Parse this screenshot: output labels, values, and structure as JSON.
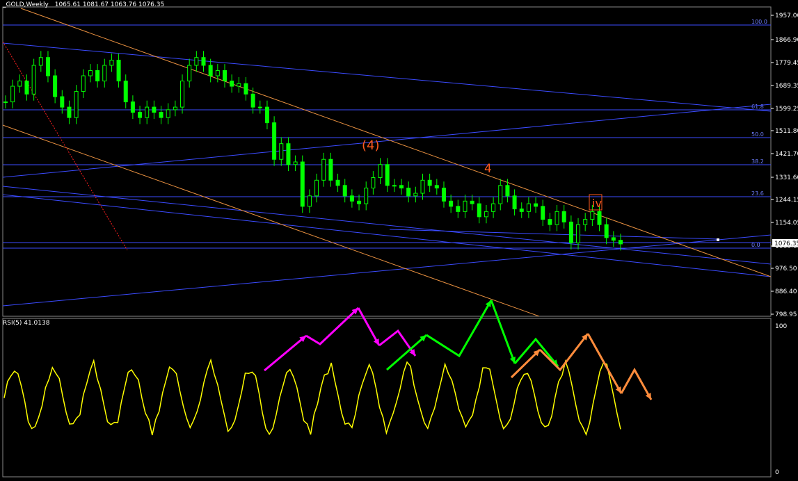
{
  "header": {
    "symbol_label": "_GOLD,Weekly",
    "ohlc": "1065.61 1081.67 1063.76 1076.35"
  },
  "rsi_panel": {
    "label": "RSI(5) 41.0138",
    "axis_ticks": [
      "100",
      "0"
    ]
  },
  "price_axis": {
    "ticks": [
      "1957.00",
      "1866.90",
      "1779.45",
      "1689.35",
      "1599.25",
      "1511.80",
      "1421.70",
      "1331.60",
      "1244.15",
      "1154.05",
      "1066.60",
      "976.50",
      "886.40",
      "798.95"
    ],
    "current_price_label": "1076.35"
  },
  "fibonacci": {
    "levels": [
      "100.0",
      "61.8",
      "50.0",
      "38.2",
      "23.6",
      "0.0"
    ]
  },
  "wave_labels": {
    "w1": "(4)",
    "w2": "4",
    "w3": "iv"
  },
  "colors": {
    "background": "#000000",
    "candle": "#00ff00",
    "horizontal_lines": "#3b4bff",
    "channel_lines": "#e89040",
    "rsi_line": "#ffff00",
    "wave_label": "#ff5a1e",
    "arrow_magenta": "#ff00ff",
    "arrow_green": "#00ff00",
    "arrow_orange": "#ff8c3c",
    "dotted_red": "#ff2020"
  },
  "chart_data": {
    "type": "candlestick",
    "title": "_GOLD,Weekly",
    "ylim": [
      798.95,
      1957.0
    ],
    "close": [
      1620,
      1680,
      1700,
      1650,
      1760,
      1790,
      1720,
      1640,
      1600,
      1560,
      1660,
      1720,
      1740,
      1700,
      1760,
      1780,
      1700,
      1620,
      1580,
      1560,
      1600,
      1580,
      1560,
      1590,
      1600,
      1700,
      1760,
      1790,
      1760,
      1720,
      1740,
      1700,
      1680,
      1690,
      1650,
      1600,
      1600,
      1540,
      1400,
      1460,
      1380,
      1390,
      1220,
      1260,
      1320,
      1400,
      1320,
      1300,
      1260,
      1240,
      1230,
      1290,
      1330,
      1380,
      1300,
      1300,
      1290,
      1260,
      1270,
      1320,
      1300,
      1290,
      1240,
      1220,
      1200,
      1240,
      1230,
      1180,
      1200,
      1230,
      1300,
      1260,
      1210,
      1200,
      1230,
      1220,
      1170,
      1150,
      1200,
      1160,
      1080,
      1150,
      1170,
      1200,
      1150,
      1100,
      1090,
      1076
    ],
    "rsi": {
      "period": 5,
      "last_value": 41.0138,
      "ylim": [
        0,
        100
      ]
    }
  }
}
